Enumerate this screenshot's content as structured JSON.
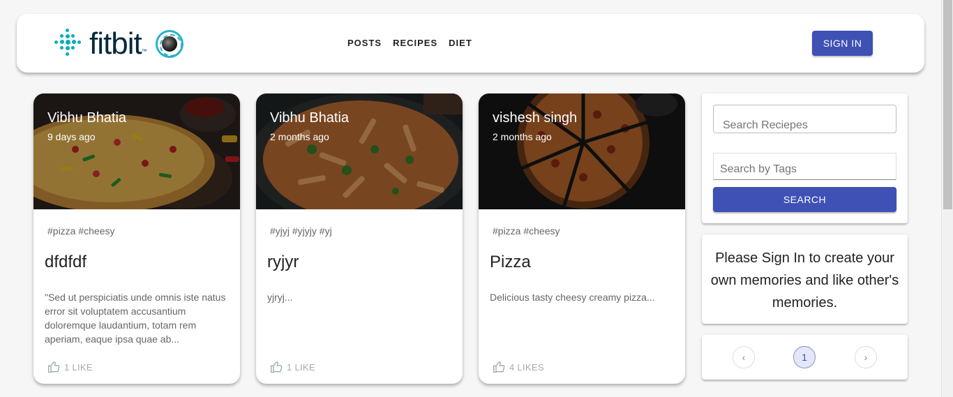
{
  "header": {
    "logo_text": "fitbit",
    "logo_tm": "™",
    "nav": [
      "POSTS",
      "RECIPES",
      "DIET"
    ],
    "signin_label": "SIGN IN"
  },
  "posts": [
    {
      "author": "Vibhu Bhatia",
      "time": "9 days ago",
      "tags": "#pizza #cheesy",
      "title": "dfdfdf",
      "message": "\"Sed ut perspiciatis unde omnis iste natus error sit voluptatem accusantium doloremque laudantium, totam rem aperiam, eaque ipsa quae ab...",
      "likes": "1 LIKE",
      "image": "pizza-image"
    },
    {
      "author": "Vibhu Bhatia",
      "time": "2 months ago",
      "tags": "#yjyj #yjyjy #yj",
      "title": "ryjyr",
      "message": "yjryj...",
      "likes": "1 LIKE",
      "image": "pasta-image"
    },
    {
      "author": "vishesh singh",
      "time": "2 months ago",
      "tags": "#pizza #cheesy",
      "title": "Pizza",
      "message": "Delicious tasty cheesy creamy pizza...",
      "likes": "4 LIKES",
      "image": "sliced-pizza-image"
    }
  ],
  "search": {
    "recipes_placeholder": "Search Reciepes",
    "tags_placeholder": "Search by Tags",
    "button_label": "SEARCH"
  },
  "signin_prompt": "Please Sign In to create your own memories and like other's memories.",
  "pagination": {
    "prev": "‹",
    "current": "1",
    "next": "›"
  },
  "colors": {
    "primary": "#3f51b5",
    "background": "#f6f6f6",
    "logo_teal": "#00b0b9"
  }
}
